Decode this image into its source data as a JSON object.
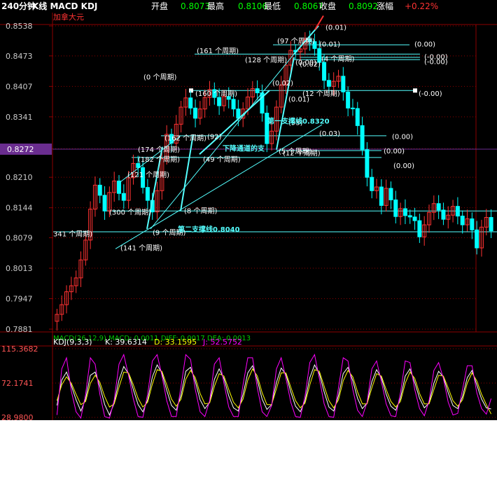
{
  "header": {
    "period": "240分钟",
    "indicators": "K线 MACD KDJ",
    "open_label": "开盘",
    "open_value": "0.8073",
    "high_label": "最高",
    "high_value": "0.8106",
    "low_label": "最低",
    "low_value": "0.8067",
    "close_label": "收盘",
    "close_value": "0.8092",
    "change_label": "涨幅",
    "change_value": "+0.22%"
  },
  "main_panel": {
    "instrument": "加拿大元",
    "price_ticks": [
      "0.8538",
      "0.8473",
      "0.8407",
      "0.8341",
      "0.8272",
      "0.8210",
      "0.8144",
      "0.8079",
      "0.8013",
      "0.7947",
      "0.7881"
    ],
    "current_price": "0.8272"
  },
  "annotations": {
    "period_labels": [
      {
        "text": "(97 个周期)"
      },
      {
        "text": "(161 个周期)"
      },
      {
        "text": "(128 个周期)"
      },
      {
        "text": "(160 个周期)"
      },
      {
        "text": "(162 个周期)"
      },
      {
        "text": "(174 个周期)"
      },
      {
        "text": "(182 个周期)"
      },
      {
        "text": "(121 个周期)"
      },
      {
        "text": "(300 个周期)"
      },
      {
        "text": "341 个周期)"
      },
      {
        "text": "(141 个周期)"
      },
      {
        "text": "(9 个周期)"
      },
      {
        "text": "(8 个周期)"
      },
      {
        "text": "(49 个周期)"
      },
      {
        "text": "(12 个周期)"
      },
      {
        "text": "(4 个周期)"
      },
      {
        "text": "(0 个周期)"
      },
      {
        "text": "(5 个周期)"
      },
      {
        "text": "(12 个周期)"
      },
      {
        "text": "(93)"
      },
      {
        "text": "(92)"
      },
      {
        "text": "(0.00)"
      }
    ],
    "value_labels": [
      {
        "text": "(0.01)"
      },
      {
        "text": "(0.01)"
      },
      {
        "text": "(0.00)"
      },
      {
        "text": "(-0.00)"
      },
      {
        "text": "(-0.00)"
      },
      {
        "text": "(-0.00)"
      },
      {
        "text": "(0.00)"
      },
      {
        "text": "(0.00)"
      },
      {
        "text": "(0.00)"
      },
      {
        "text": "(0.03)"
      },
      {
        "text": "(0.02)"
      },
      {
        "text": "(0.02)"
      },
      {
        "text": "(0.01)"
      }
    ],
    "notes": [
      {
        "text": "第一支撑线0.8320"
      },
      {
        "text": "下降通道的支"
      },
      {
        "text": "第二支撑线0.8040"
      }
    ]
  },
  "macd_line": "MACD(26,12,9) MACD: 0.0011 DIFF: 0.0017 DEA: 0.0013",
  "kdj_panel": {
    "label_name": "KDJ(9,3,3)",
    "k_label": "K: 39.6314",
    "d_label": "D: 33.1595",
    "j_label": "J: 52.5752",
    "ticks": [
      "115.3682",
      "72.1741",
      "28.9800"
    ]
  },
  "colors": {
    "background": "#000000",
    "up": "#ff3232",
    "down": "#00ffff",
    "grid": "#8b0000",
    "trend": "#54ffff",
    "k": "#ffffff",
    "d": "#ffff00",
    "j": "#ff00ff"
  },
  "chart_data": [
    {
      "type": "candlestick",
      "title": "加拿大元",
      "ylim": [
        0.7881,
        0.8538
      ],
      "series": [
        {
          "name": "K线",
          "values": [
            0.7913,
            0.7934,
            0.7962,
            0.7975,
            0.7992,
            0.8031,
            0.8074,
            0.8141,
            0.8193,
            0.8171,
            0.8137,
            0.8177,
            0.8202,
            0.8175,
            0.816,
            0.8209,
            0.824,
            0.8231,
            0.8188,
            0.816,
            0.8135,
            0.8181,
            0.825,
            0.8303,
            0.8284,
            0.8325,
            0.8362,
            0.8382,
            0.836,
            0.8338,
            0.8358,
            0.8383,
            0.84,
            0.8383,
            0.8365,
            0.8385,
            0.8379,
            0.8358,
            0.8338,
            0.8358,
            0.8384,
            0.8402,
            0.8393,
            0.8349,
            0.8283,
            0.831,
            0.8362,
            0.841,
            0.8453,
            0.8485,
            0.8482,
            0.8488,
            0.8509,
            0.8504,
            0.8489,
            0.8459,
            0.842,
            0.8407,
            0.8418,
            0.8429,
            0.8395,
            0.836,
            0.8359,
            0.8322,
            0.827,
            0.821,
            0.8181,
            0.8189,
            0.8149,
            0.8186,
            0.8161,
            0.8125,
            0.8142,
            0.8127,
            0.8124,
            0.8116,
            0.8081,
            0.8107,
            0.8134,
            0.8153,
            0.8139,
            0.8119,
            0.8128,
            0.8147,
            0.8126,
            0.8107,
            0.812,
            0.8096,
            0.8057,
            0.8102,
            0.8123,
            0.8094
          ]
        }
      ]
    },
    {
      "type": "line",
      "title": "KDJ(9,3,3)",
      "ylim": [
        28.98,
        115.3682
      ],
      "series": [
        {
          "name": "K",
          "values": [
            44,
            76,
            86,
            69,
            51,
            37,
            52,
            82,
            86,
            68,
            45,
            32,
            47,
            76,
            93,
            84,
            64,
            45,
            36,
            51,
            80,
            95,
            85,
            63,
            44,
            38,
            57,
            87,
            92,
            74,
            51,
            40,
            48,
            77,
            90,
            78,
            56,
            41,
            37,
            58,
            85,
            94,
            76,
            52,
            39,
            45,
            73,
            91,
            83,
            61,
            43,
            36,
            50,
            79,
            95,
            84,
            61,
            42,
            37,
            56,
            84,
            92,
            75,
            53,
            40,
            47,
            74,
            89,
            79,
            58,
            43,
            38,
            53,
            81,
            90,
            73,
            53,
            41,
            47,
            72,
            87,
            80,
            60,
            44,
            40,
            55,
            79,
            88,
            70,
            52,
            41,
            39.6
          ]
        },
        {
          "name": "D",
          "values": [
            50,
            70,
            80,
            72,
            58,
            45,
            49,
            72,
            82,
            73,
            55,
            42,
            46,
            67,
            86,
            85,
            70,
            53,
            42,
            48,
            71,
            89,
            87,
            70,
            52,
            43,
            52,
            77,
            88,
            79,
            59,
            46,
            47,
            68,
            84,
            81,
            64,
            48,
            41,
            52,
            76,
            90,
            81,
            60,
            45,
            45,
            65,
            85,
            85,
            67,
            50,
            41,
            47,
            70,
            89,
            87,
            68,
            50,
            41,
            51,
            75,
            88,
            80,
            61,
            46,
            46,
            66,
            84,
            81,
            64,
            49,
            42,
            49,
            72,
            86,
            78,
            59,
            46,
            46,
            64,
            82,
            81,
            66,
            50,
            43,
            51,
            72,
            85,
            75,
            58,
            45,
            33.2
          ]
        },
        {
          "name": "J",
          "values": [
            32,
            90,
            104,
            62,
            36,
            28,
            58,
            104,
            96,
            58,
            30,
            28,
            51,
            96,
            108,
            82,
            52,
            30,
            29,
            58,
            100,
            108,
            82,
            50,
            30,
            30,
            68,
            108,
            102,
            64,
            36,
            30,
            50,
            96,
            104,
            72,
            42,
            30,
            30,
            70,
            104,
            104,
            66,
            36,
            30,
            44,
            90,
            104,
            78,
            48,
            30,
            29,
            56,
            98,
            108,
            78,
            46,
            30,
            29,
            66,
            104,
            100,
            64,
            38,
            30,
            48,
            90,
            100,
            74,
            46,
            31,
            30,
            60,
            100,
            98,
            64,
            40,
            31,
            50,
            88,
            98,
            78,
            48,
            32,
            34,
            64,
            94,
            94,
            60,
            40,
            33,
            52.6
          ]
        }
      ]
    }
  ]
}
